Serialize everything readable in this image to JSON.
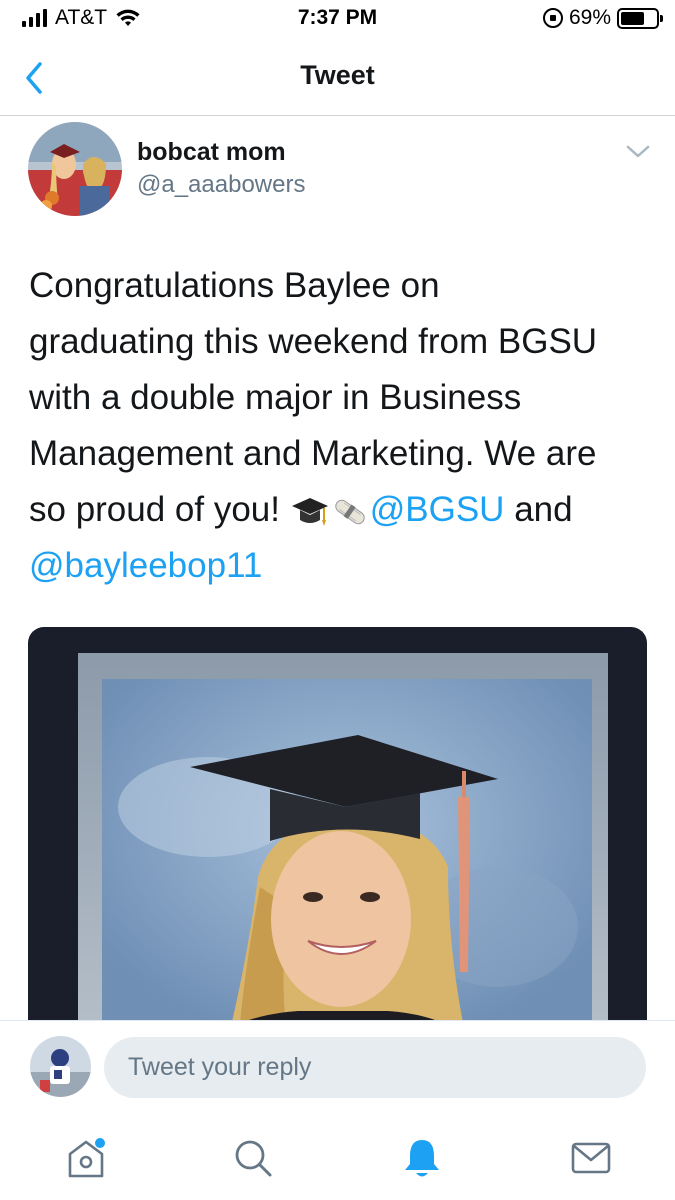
{
  "status_bar": {
    "carrier": "AT&T",
    "time": "7:37 PM",
    "battery": "69%",
    "battery_level": 0.69,
    "icons": [
      "signal-icon",
      "wifi-icon",
      "rotation-lock-icon",
      "battery-icon"
    ]
  },
  "nav": {
    "title": "Tweet",
    "back_icon": "chevron-left-icon"
  },
  "tweet": {
    "display_name": "bobcat mom",
    "handle": "@a_aaabowers",
    "text_lines": [
      "Congratulations Baylee on",
      "graduating this weekend from BGSU",
      "with a double major in Business",
      "Management and Marketing. We are"
    ],
    "text_line5_prefix": "so proud of you! ",
    "emojis": [
      "graduation-cap-emoji",
      "diploma-emoji"
    ],
    "mention_1": "@BGSU",
    "text_connector": " and",
    "mention_2": "@bayleebop11",
    "menu_icon": "chevron-down-icon"
  },
  "reply": {
    "placeholder": "Tweet your reply"
  },
  "tab_bar": {
    "tabs": [
      {
        "icon": "home-icon",
        "has_notification_dot": true
      },
      {
        "icon": "search-icon",
        "active": false
      },
      {
        "icon": "bell-icon",
        "active": true
      },
      {
        "icon": "mail-icon",
        "active": false
      }
    ]
  },
  "colors": {
    "link": "#1da1f2",
    "text": "#14171a",
    "secondary": "#657786",
    "input_bg": "#e6ecf0"
  }
}
